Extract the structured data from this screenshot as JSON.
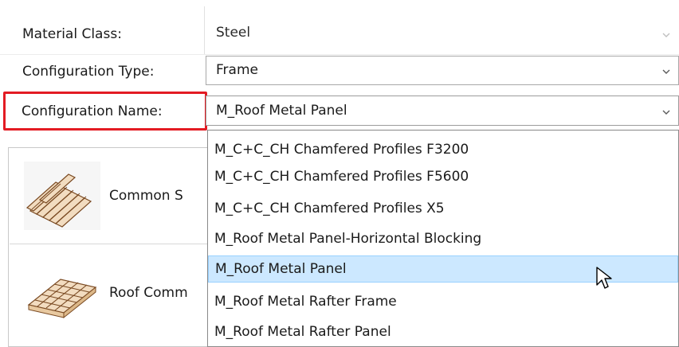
{
  "properties": {
    "material_class": {
      "label": "Material Class:",
      "value": "Steel"
    },
    "configuration_type": {
      "label": "Configuration Type:",
      "value": "Frame"
    },
    "configuration_name": {
      "label": "Configuration Name:",
      "value": "M_Roof Metal Panel"
    }
  },
  "dropdown": {
    "options": [
      "M_C+C_CH Chamfered Profiles F3200",
      "M_C+C_CH Chamfered Profiles F5600",
      "M_C+C_CH Chamfered Profiles X5",
      "M_Roof Metal Panel-Horizontal Blocking",
      "M_Roof Metal Panel",
      "M_Roof Metal Rafter Frame",
      "M_Roof Metal Rafter Panel"
    ],
    "selected_index": 4
  },
  "palette": {
    "tiles": [
      {
        "label": "Common S",
        "icon": "parallel-slats-icon"
      },
      {
        "label": "Roof Comm",
        "icon": "lattice-framing-icon"
      }
    ]
  },
  "colors": {
    "highlight_border": "#e31b23",
    "selected_row": "#cce8ff",
    "selected_row_border": "#99d1ff"
  }
}
